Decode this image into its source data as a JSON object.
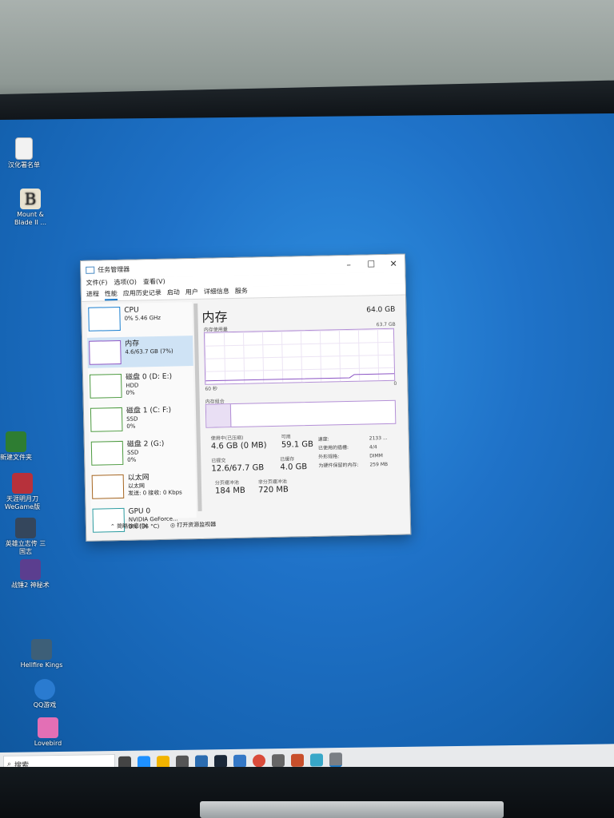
{
  "desktop": {
    "icons": [
      {
        "label": "汉化署名单",
        "color": "#f2f2f2"
      },
      {
        "label": "Mount & Blade II ...",
        "color": "#e8e2d0"
      },
      {
        "label": "新建文件夹",
        "color": "#2e7d32"
      },
      {
        "label": "天涯明月刀 WeGame版",
        "color": "#b7313b"
      },
      {
        "label": "英雄立志传 三国志",
        "color": "#34465c"
      },
      {
        "label": "战锤2 神秘术",
        "color": "#5b3e8f"
      },
      {
        "label": "Hellfire Kings",
        "color": "#3d5f78"
      },
      {
        "label": "QQ游戏",
        "color": "#2a7bd0"
      },
      {
        "label": "Lovebird",
        "color": "#e36fb5"
      }
    ]
  },
  "taskbar": {
    "search_text": "搜索",
    "icons": [
      "task-view-icon",
      "edge-icon",
      "file-explorer-icon",
      "store-icon",
      "mail-icon",
      "steam-icon",
      "media-icon",
      "chrome-icon",
      "settings-icon",
      "app-icon",
      "app2-icon",
      "monitor-icon"
    ]
  },
  "window": {
    "title": "任务管理器",
    "menu": [
      "文件(F)",
      "选项(O)",
      "查看(V)"
    ],
    "tabs": [
      "进程",
      "性能",
      "应用历史记录",
      "启动",
      "用户",
      "详细信息",
      "服务"
    ],
    "active_tab": "性能",
    "left_items": [
      {
        "name": "CPU",
        "line1": "0% 5.46 GHz",
        "line2": "",
        "type": "cpu"
      },
      {
        "name": "内存",
        "line1": "4.6/63.7 GB (7%)",
        "line2": "",
        "type": "mem",
        "selected": true
      },
      {
        "name": "磁盘 0 (D: E:)",
        "line1": "HDD",
        "line2": "0%",
        "type": "disk"
      },
      {
        "name": "磁盘 1 (C: F:)",
        "line1": "SSD",
        "line2": "0%",
        "type": "disk"
      },
      {
        "name": "磁盘 2 (G:)",
        "line1": "SSD",
        "line2": "0%",
        "type": "disk"
      },
      {
        "name": "以太网",
        "line1": "以太网",
        "line2": "发送: 0 接收: 0 Kbps",
        "type": "net"
      },
      {
        "name": "GPU 0",
        "line1": "NVIDIA GeForce...",
        "line2": "0% (36 °C)",
        "type": "gpu"
      }
    ],
    "memory": {
      "title": "内存",
      "total": "64.0 GB",
      "usage_label": "内存使用量",
      "usage_max": "63.7 GB",
      "axis_left": "60 秒",
      "axis_right": "0",
      "composition_label": "内存组合",
      "in_use_label": "使用中(已压缩)",
      "in_use": "4.6 GB (0 MB)",
      "available_label": "可用",
      "available": "59.1 GB",
      "committed_label": "已提交",
      "committed": "12.6/67.7 GB",
      "cached_label": "已缓存",
      "cached": "4.0 GB",
      "paged_label": "分页缓冲池",
      "paged": "184 MB",
      "nonpaged_label": "非分页缓冲池",
      "nonpaged": "720 MB",
      "speed_label": "速度:",
      "speed": "2133 ...",
      "slots_label": "已使用的插槽:",
      "slots": "4/4",
      "form_label": "外形规格:",
      "form": "DIMM",
      "reserved_label": "为硬件保留的内存:",
      "reserved": "259 MB"
    },
    "footer": {
      "fewer_details": "简略信息(D)",
      "open_monitor": "打开资源监视器"
    }
  }
}
